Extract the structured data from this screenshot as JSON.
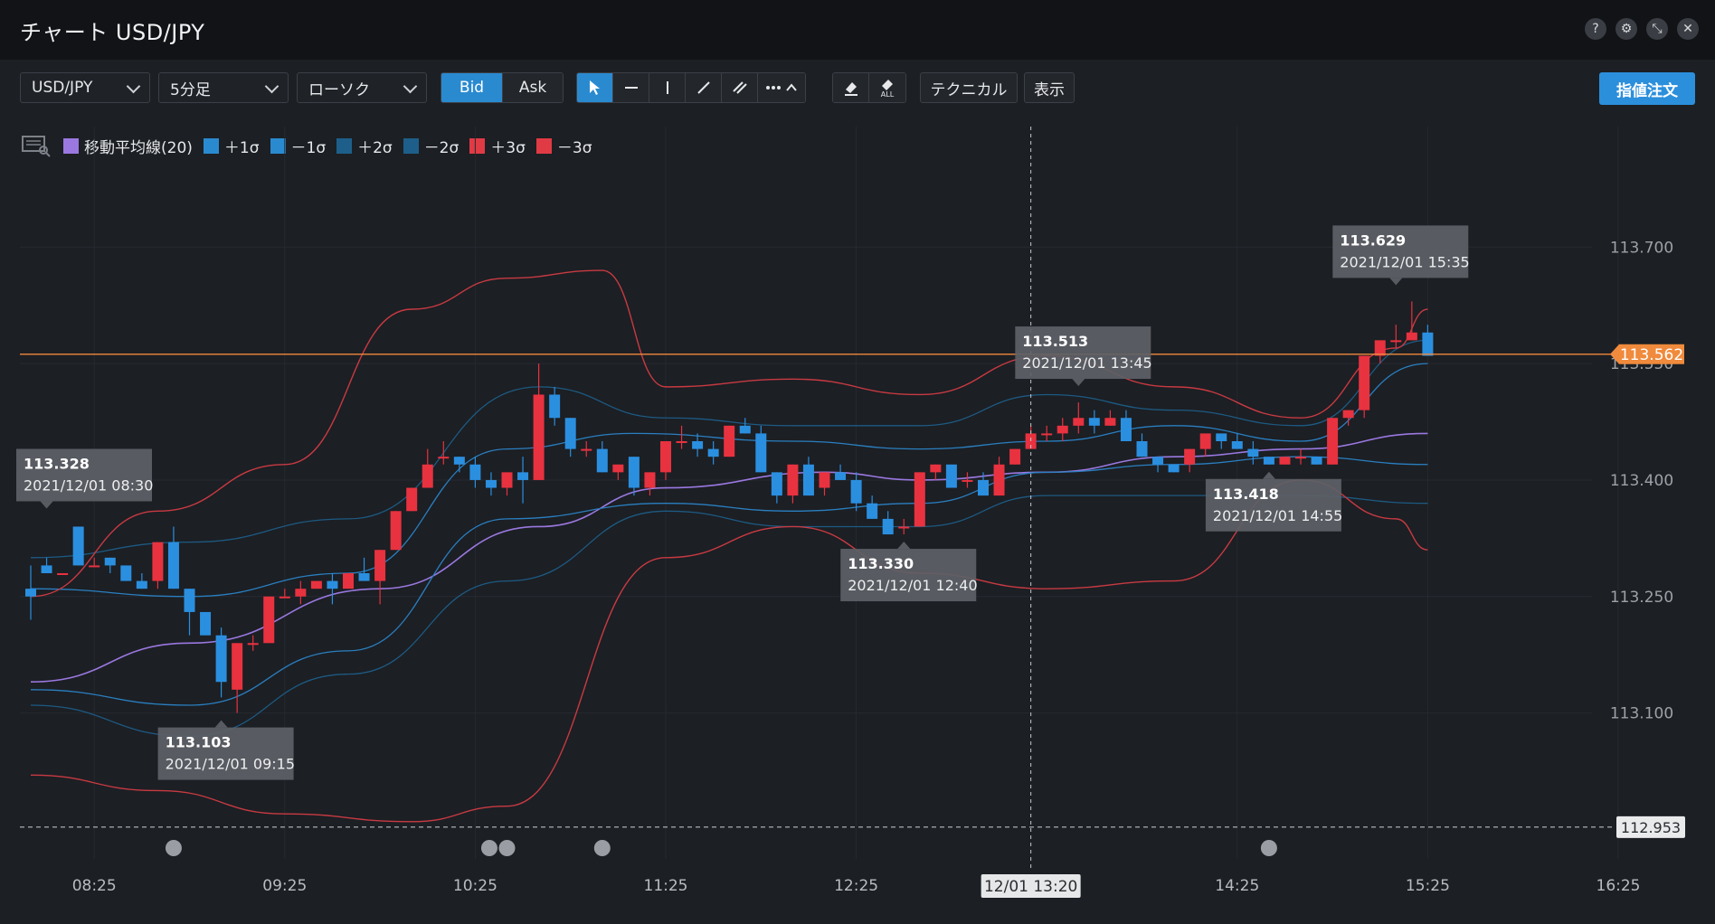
{
  "window": {
    "title": "チャート USD/JPY",
    "controls": [
      {
        "icon": "help-icon",
        "glyph": "?"
      },
      {
        "icon": "gear-icon",
        "glyph": "⚙"
      },
      {
        "icon": "collapse-icon",
        "glyph": "⤡"
      },
      {
        "icon": "close-icon",
        "glyph": "✕"
      }
    ]
  },
  "toolbar": {
    "symbol": "USD/JPY",
    "timeframe": "5分足",
    "chart_type": "ローソク",
    "bid_label": "Bid",
    "ask_label": "Ask",
    "active_price": "Bid",
    "draw_tools": [
      {
        "icon": "cursor-icon",
        "glyph": "↖",
        "active": true
      },
      {
        "icon": "horizontal-line-icon",
        "glyph": "—"
      },
      {
        "icon": "vertical-line-icon",
        "glyph": "|"
      },
      {
        "icon": "trend-line-icon",
        "glyph": "/"
      },
      {
        "icon": "parallel-lines-icon",
        "glyph": "//"
      },
      {
        "icon": "more-tools-icon",
        "glyph": "··· ^"
      }
    ],
    "erase_tools": [
      {
        "icon": "eraser-icon",
        "glyph": "⌫"
      },
      {
        "icon": "eraser-all-icon",
        "glyph": "⌫",
        "sub": "ALL"
      }
    ],
    "technical_label": "テクニカル",
    "display_label": "表示",
    "order_label": "指値注文"
  },
  "legend": [
    {
      "label": "移動平均線(20)",
      "color": "#9a78e0"
    },
    {
      "label": "＋1σ",
      "color": "#2a8ad0"
    },
    {
      "label": "－1σ",
      "color": "#2a8ad0"
    },
    {
      "label": "＋2σ",
      "color": "#1d5f8a"
    },
    {
      "label": "－2σ",
      "color": "#1d5f8a"
    },
    {
      "label": "＋3σ",
      "color": "#e03a45"
    },
    {
      "label": "－3σ",
      "color": "#e03a45"
    }
  ],
  "colors": {
    "up_candle": "#e8323f",
    "down_candle": "#2b8fe0",
    "price_line": "#f08a3c",
    "ma": "#9a78e0",
    "band1": "#2a7fc0",
    "band2": "#1d5a82",
    "band3": "#c83a42"
  },
  "chart_data": {
    "type": "candlestick",
    "title": "",
    "ylim": [
      112.94,
      113.79
    ],
    "y_ticks": [
      "113.700",
      "113.550",
      "113.400",
      "113.250",
      "113.100"
    ],
    "x_ticks": [
      "08:25",
      "09:25",
      "10:25",
      "11:25",
      "12:25",
      "14:25",
      "15:25",
      "16:25"
    ],
    "x_start": "08:05",
    "interval_minutes": 5,
    "current_price": "113.562",
    "low_level": "112.953",
    "crosshair_label": "12/01 13:20",
    "candles": [
      [
        113.26,
        113.29,
        113.25,
        113.22
      ],
      [
        113.29,
        113.3,
        113.28,
        113.28
      ],
      [
        113.28,
        113.34,
        113.28,
        113.34
      ],
      [
        113.34,
        113.34,
        113.29,
        113.29
      ],
      [
        113.29,
        113.3,
        113.29,
        113.29
      ],
      [
        113.3,
        113.3,
        113.29,
        113.28
      ],
      [
        113.29,
        113.29,
        113.27,
        113.27
      ],
      [
        113.27,
        113.28,
        113.26,
        113.26
      ],
      [
        113.27,
        113.32,
        113.32,
        113.26
      ],
      [
        113.32,
        113.34,
        113.26,
        113.26
      ],
      [
        113.26,
        113.26,
        113.23,
        113.2
      ],
      [
        113.23,
        113.23,
        113.2,
        113.2
      ],
      [
        113.2,
        113.21,
        113.14,
        113.12
      ],
      [
        113.13,
        113.19,
        113.19,
        113.1
      ],
      [
        113.19,
        113.2,
        113.19,
        113.18
      ],
      [
        113.19,
        113.25,
        113.25,
        113.19
      ],
      [
        113.25,
        113.26,
        113.25,
        113.25
      ],
      [
        113.25,
        113.27,
        113.26,
        113.24
      ],
      [
        113.26,
        113.27,
        113.27,
        113.26
      ],
      [
        113.27,
        113.28,
        113.26,
        113.24
      ],
      [
        113.26,
        113.28,
        113.28,
        113.26
      ],
      [
        113.28,
        113.3,
        113.27,
        113.27
      ],
      [
        113.27,
        113.31,
        113.31,
        113.24
      ],
      [
        113.31,
        113.36,
        113.36,
        113.31
      ],
      [
        113.36,
        113.39,
        113.39,
        113.36
      ],
      [
        113.39,
        113.44,
        113.42,
        113.39
      ],
      [
        113.43,
        113.45,
        113.43,
        113.42
      ],
      [
        113.43,
        113.43,
        113.42,
        113.41
      ],
      [
        113.42,
        113.43,
        113.4,
        113.39
      ],
      [
        113.4,
        113.41,
        113.39,
        113.38
      ],
      [
        113.39,
        113.4,
        113.41,
        113.38
      ],
      [
        113.41,
        113.43,
        113.4,
        113.37
      ],
      [
        113.4,
        113.55,
        113.51,
        113.4
      ],
      [
        113.51,
        113.52,
        113.48,
        113.47
      ],
      [
        113.48,
        113.48,
        113.44,
        113.43
      ],
      [
        113.44,
        113.45,
        113.44,
        113.43
      ],
      [
        113.44,
        113.45,
        113.41,
        113.41
      ],
      [
        113.41,
        113.42,
        113.42,
        113.4
      ],
      [
        113.43,
        113.43,
        113.39,
        113.38
      ],
      [
        113.39,
        113.41,
        113.41,
        113.38
      ],
      [
        113.41,
        113.44,
        113.45,
        113.4
      ],
      [
        113.45,
        113.47,
        113.45,
        113.44
      ],
      [
        113.45,
        113.46,
        113.44,
        113.43
      ],
      [
        113.44,
        113.45,
        113.43,
        113.42
      ],
      [
        113.43,
        113.47,
        113.47,
        113.43
      ],
      [
        113.47,
        113.48,
        113.46,
        113.46
      ],
      [
        113.46,
        113.47,
        113.41,
        113.41
      ],
      [
        113.41,
        113.41,
        113.38,
        113.37
      ],
      [
        113.38,
        113.42,
        113.42,
        113.37
      ],
      [
        113.42,
        113.43,
        113.38,
        113.38
      ],
      [
        113.39,
        113.41,
        113.41,
        113.38
      ],
      [
        113.41,
        113.42,
        113.4,
        113.4
      ],
      [
        113.4,
        113.41,
        113.37,
        113.36
      ],
      [
        113.37,
        113.38,
        113.35,
        113.35
      ],
      [
        113.35,
        113.36,
        113.33,
        113.33
      ],
      [
        113.34,
        113.35,
        113.34,
        113.33
      ],
      [
        113.34,
        113.41,
        113.41,
        113.34
      ],
      [
        113.41,
        113.42,
        113.42,
        113.4
      ],
      [
        113.42,
        113.42,
        113.39,
        113.39
      ],
      [
        113.4,
        113.41,
        113.4,
        113.39
      ],
      [
        113.4,
        113.41,
        113.38,
        113.38
      ],
      [
        113.38,
        113.43,
        113.42,
        113.38
      ],
      [
        113.42,
        113.44,
        113.44,
        113.42
      ],
      [
        113.44,
        113.47,
        113.46,
        113.44
      ],
      [
        113.46,
        113.47,
        113.46,
        113.45
      ],
      [
        113.46,
        113.48,
        113.47,
        113.45
      ],
      [
        113.47,
        113.5,
        113.48,
        113.46
      ],
      [
        113.48,
        113.49,
        113.47,
        113.46
      ],
      [
        113.47,
        113.49,
        113.48,
        113.47
      ],
      [
        113.48,
        113.49,
        113.45,
        113.45
      ],
      [
        113.45,
        113.46,
        113.43,
        113.43
      ],
      [
        113.43,
        113.43,
        113.42,
        113.41
      ],
      [
        113.42,
        113.42,
        113.41,
        113.41
      ],
      [
        113.42,
        113.44,
        113.44,
        113.41
      ],
      [
        113.44,
        113.45,
        113.46,
        113.43
      ],
      [
        113.46,
        113.46,
        113.45,
        113.44
      ],
      [
        113.45,
        113.46,
        113.44,
        113.44
      ],
      [
        113.44,
        113.45,
        113.43,
        113.42
      ],
      [
        113.43,
        113.43,
        113.42,
        113.42
      ],
      [
        113.42,
        113.43,
        113.43,
        113.42
      ],
      [
        113.43,
        113.44,
        113.43,
        113.42
      ],
      [
        113.43,
        113.43,
        113.42,
        113.42
      ],
      [
        113.42,
        113.48,
        113.48,
        113.42
      ],
      [
        113.48,
        113.49,
        113.49,
        113.47
      ],
      [
        113.49,
        113.56,
        113.56,
        113.48
      ],
      [
        113.56,
        113.58,
        113.58,
        113.55
      ],
      [
        113.58,
        113.6,
        113.58,
        113.57
      ],
      [
        113.58,
        113.63,
        113.59,
        113.58
      ],
      [
        113.59,
        113.6,
        113.56,
        113.56
      ]
    ],
    "overlays": {
      "ma": [
        [
          0,
          113.14
        ],
        [
          10,
          113.19
        ],
        [
          22,
          113.26
        ],
        [
          32,
          113.34
        ],
        [
          40,
          113.39
        ],
        [
          50,
          113.41
        ],
        [
          56,
          113.4
        ],
        [
          64,
          113.41
        ],
        [
          72,
          113.43
        ],
        [
          80,
          113.44
        ],
        [
          88,
          113.46
        ]
      ],
      "plus1": [
        [
          0,
          113.26
        ],
        [
          10,
          113.25
        ],
        [
          20,
          113.28
        ],
        [
          30,
          113.44
        ],
        [
          38,
          113.46
        ],
        [
          48,
          113.45
        ],
        [
          56,
          113.44
        ],
        [
          64,
          113.45
        ],
        [
          72,
          113.47
        ],
        [
          80,
          113.45
        ],
        [
          88,
          113.55
        ]
      ],
      "minus1": [
        [
          0,
          113.13
        ],
        [
          10,
          113.11
        ],
        [
          20,
          113.18
        ],
        [
          30,
          113.35
        ],
        [
          40,
          113.37
        ],
        [
          48,
          113.36
        ],
        [
          56,
          113.37
        ],
        [
          64,
          113.41
        ],
        [
          72,
          113.42
        ],
        [
          80,
          113.43
        ],
        [
          88,
          113.42
        ]
      ],
      "plus2": [
        [
          0,
          113.3
        ],
        [
          10,
          113.32
        ],
        [
          20,
          113.35
        ],
        [
          32,
          113.52
        ],
        [
          40,
          113.48
        ],
        [
          48,
          113.47
        ],
        [
          56,
          113.47
        ],
        [
          64,
          113.51
        ],
        [
          72,
          113.49
        ],
        [
          80,
          113.47
        ],
        [
          88,
          113.58
        ]
      ],
      "minus2": [
        [
          0,
          113.11
        ],
        [
          10,
          113.07
        ],
        [
          20,
          113.15
        ],
        [
          30,
          113.27
        ],
        [
          40,
          113.36
        ],
        [
          48,
          113.34
        ],
        [
          56,
          113.34
        ],
        [
          64,
          113.38
        ],
        [
          72,
          113.38
        ],
        [
          80,
          113.38
        ],
        [
          88,
          113.37
        ]
      ],
      "plus3": [
        [
          0,
          113.25
        ],
        [
          8,
          113.36
        ],
        [
          16,
          113.42
        ],
        [
          24,
          113.62
        ],
        [
          30,
          113.66
        ],
        [
          36,
          113.67
        ],
        [
          40,
          113.52
        ],
        [
          48,
          113.53
        ],
        [
          56,
          113.51
        ],
        [
          64,
          113.56
        ],
        [
          72,
          113.52
        ],
        [
          80,
          113.48
        ],
        [
          86,
          113.57
        ],
        [
          88,
          113.62
        ]
      ],
      "minus3": [
        [
          0,
          113.02
        ],
        [
          8,
          113.0
        ],
        [
          16,
          112.97
        ],
        [
          24,
          112.96
        ],
        [
          30,
          112.98
        ],
        [
          40,
          113.3
        ],
        [
          48,
          113.34
        ],
        [
          56,
          113.28
        ],
        [
          64,
          113.26
        ],
        [
          72,
          113.27
        ],
        [
          80,
          113.4
        ],
        [
          86,
          113.35
        ],
        [
          88,
          113.31
        ]
      ]
    },
    "callouts": [
      {
        "value": "113.328",
        "time": "2021/12/01 08:30",
        "anchor_index": 1,
        "price": 113.34,
        "side": "above-left"
      },
      {
        "value": "113.103",
        "time": "2021/12/01 09:15",
        "anchor_index": 12,
        "price": 113.1,
        "side": "below"
      },
      {
        "value": "113.330",
        "time": "2021/12/01 12:40",
        "anchor_index": 55,
        "price": 113.33,
        "side": "below"
      },
      {
        "value": "113.513",
        "time": "2021/12/01 13:45",
        "anchor_index": 66,
        "price": 113.5,
        "side": "above"
      },
      {
        "value": "113.418",
        "time": "2021/12/01 14:55",
        "anchor_index": 78,
        "price": 113.42,
        "side": "below"
      },
      {
        "value": "113.629",
        "time": "2021/12/01 15:35",
        "anchor_index": 86,
        "price": 113.63,
        "side": "above"
      }
    ],
    "event_marker_indices": [
      9,
      29,
      30,
      36,
      78
    ]
  }
}
